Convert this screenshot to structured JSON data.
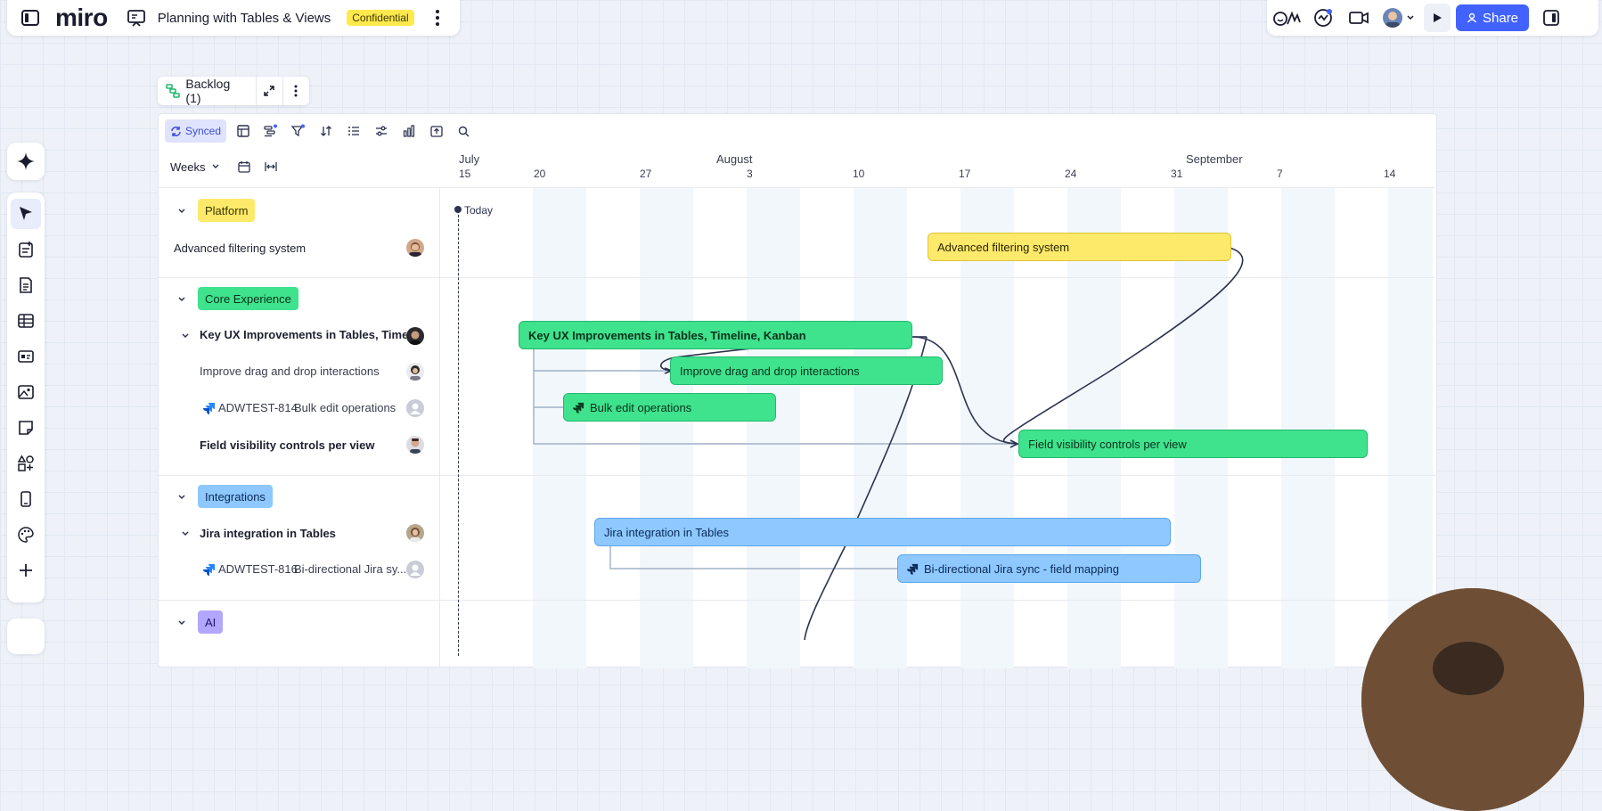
{
  "app": {
    "logo": "miro",
    "board_title": "Planning with Tables & Views",
    "confidentiality_badge": "Confidential",
    "share_label": "Share"
  },
  "icons": {
    "sidebar_toggle": "sidebar-toggle-icon",
    "board": "board-icon",
    "more": "more-vertical-icon",
    "reactions": "reactions-icon",
    "activity": "activity-icon",
    "video": "video-call-icon",
    "present": "play-icon",
    "panel": "right-panel-icon"
  },
  "backlog": {
    "label": "Backlog (1)"
  },
  "toolbar": {
    "synced_label": "Synced",
    "scale_label": "Weeks"
  },
  "timeline": {
    "months": [
      "July",
      "August",
      "September"
    ],
    "ticks": [
      "15",
      "20",
      "27",
      "3",
      "10",
      "17",
      "24",
      "31",
      "7",
      "14"
    ],
    "today_label": "Today"
  },
  "groups": {
    "platform": "Platform",
    "core": "Core Experience",
    "integrations": "Integrations",
    "ai": "AI"
  },
  "rows": {
    "advanced_filtering": "Advanced filtering system",
    "key_ux": "Key UX Improvements in Tables, Timelin",
    "drag_drop": "Improve drag and drop interactions",
    "adw814_key": "ADWTEST-814",
    "adw814_title": "Bulk edit operations",
    "field_visibility": "Field visibility controls per view",
    "jira_integration": "Jira integration in Tables",
    "adw816_key": "ADWTEST-816",
    "adw816_title": "Bi-directional Jira sy..."
  },
  "bars": {
    "advanced_filtering": "Advanced filtering system",
    "key_ux": "Key UX Improvements in Tables, Timeline, Kanban",
    "drag_drop": "Improve drag and drop interactions",
    "bulk_edit": "Bulk edit operations",
    "field_visibility": "Field visibility controls per view",
    "jira_integration": "Jira integration in Tables",
    "jira_sync": "Bi-directional Jira sync - field mapping"
  },
  "colors": {
    "accent": "#4262ff",
    "platform": "#fde96a",
    "core": "#3fe28d",
    "integrations": "#8ec8ff",
    "ai": "#b3a6ff",
    "badge": "#ffe94d"
  }
}
